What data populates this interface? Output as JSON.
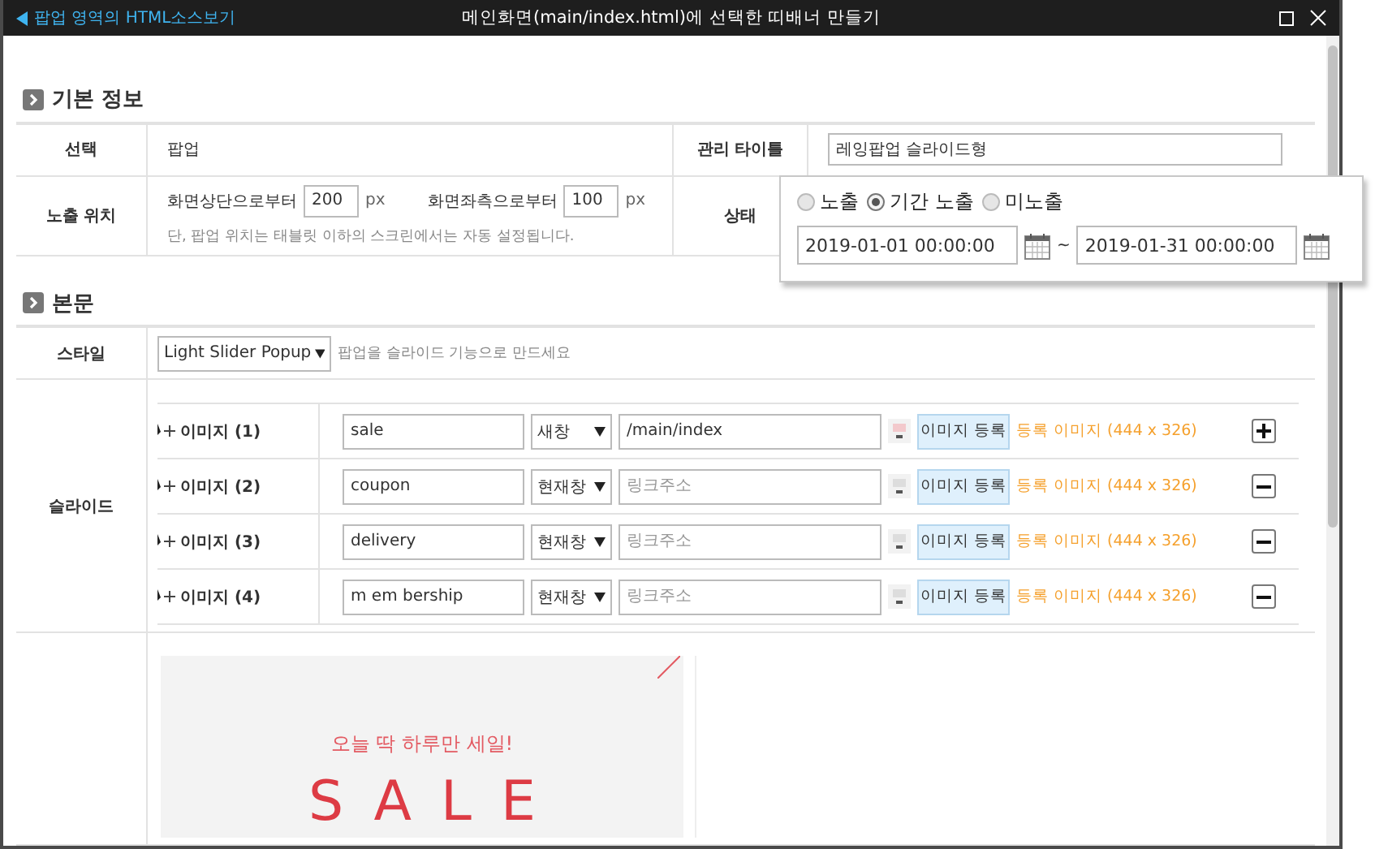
{
  "window": {
    "back_link": "팝업 영역의 HTML소스보기",
    "title": "메인화면(main/index.html)에 선택한 띠배너 만들기"
  },
  "basic_info": {
    "heading": "기본 정보",
    "select_label": "선택",
    "select_value": "팝업",
    "admin_title_label": "관리 타이틀",
    "admin_title_value": "레잉팝업 슬라이드형",
    "position_label": "노출 위치",
    "top_label": "화면상단으로부터",
    "top_value": "200",
    "top_unit": "px",
    "left_label": "화면좌측으로부터",
    "left_value": "100",
    "left_unit": "px",
    "position_note": "단, 팝업 위치는 태블릿 이하의 스크린에서는 자동 설정됩니다.",
    "status_label": "상태"
  },
  "status_popup": {
    "options": [
      {
        "label": "노출",
        "selected": false
      },
      {
        "label": "기간 노출",
        "selected": true
      },
      {
        "label": "미노출",
        "selected": false
      }
    ],
    "start": "2019-01-01 00:00:00",
    "separator": "~",
    "end": "2019-01-31 00:00:00"
  },
  "body": {
    "heading": "본문",
    "style_label": "스타일",
    "style_value": "Light Slider Popup",
    "style_note": "팝업을 슬라이드 기능으로 만드세요",
    "slide_label": "슬라이드",
    "slides": [
      {
        "label": "이미지 (1)",
        "name": "sale",
        "target": "새창",
        "link": "/main/index",
        "register": "이미지 등록",
        "result": "등록 이미지 (444 x 326)",
        "kind": "add"
      },
      {
        "label": "이미지 (2)",
        "name": "coupon",
        "target": "현재창",
        "link_placeholder": "링크주소",
        "register": "이미지 등록",
        "result": "등록 이미지 (444 x 326)",
        "kind": "remove"
      },
      {
        "label": "이미지 (3)",
        "name": "delivery",
        "target": "현재창",
        "link_placeholder": "링크주소",
        "register": "이미지 등록",
        "result": "등록 이미지 (444 x 326)",
        "kind": "remove"
      },
      {
        "label": "이미지 (4)",
        "name": "m em bership",
        "target": "현재창",
        "link_placeholder": "링크주소",
        "register": "이미지 등록",
        "result": "등록 이미지 (444 x 326)",
        "kind": "remove"
      }
    ],
    "preview": {
      "subtitle": "오늘 딱 하루만 세일!",
      "headline": "SALE"
    }
  }
}
